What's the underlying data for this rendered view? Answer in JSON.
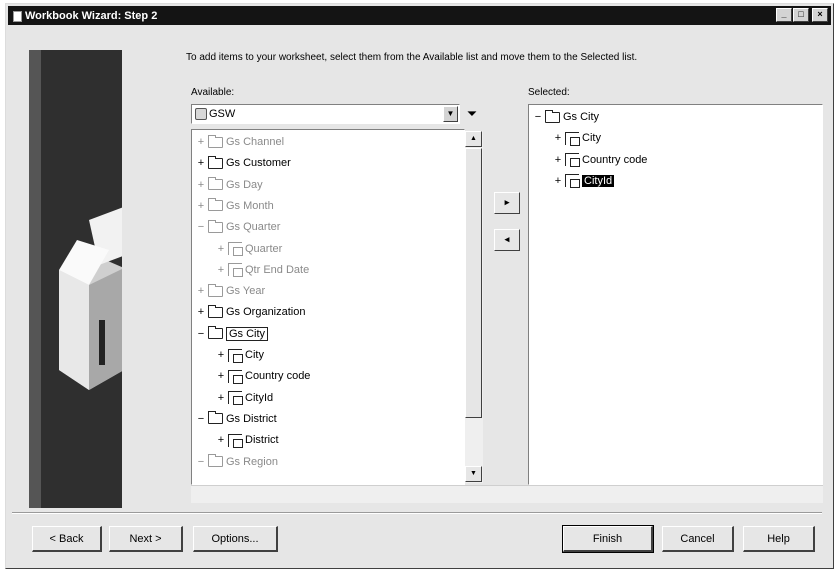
{
  "window": {
    "title": "Workbook Wizard: Step 2",
    "controls": [
      "_",
      "□",
      "×"
    ]
  },
  "instructions": "To add items to your worksheet, select them from the Available list and move them to the Selected list.",
  "available": {
    "label": "Available:",
    "combo_value": "GSW",
    "rows": [
      {
        "exp": "+",
        "icon": "folder",
        "text": "Gs Channel",
        "style": "dim"
      },
      {
        "exp": "+",
        "icon": "folder",
        "text": "Gs Customer",
        "style": ""
      },
      {
        "exp": "+",
        "icon": "folder",
        "text": "Gs Day",
        "style": "dim"
      },
      {
        "exp": "+",
        "icon": "folder",
        "text": "Gs Month",
        "style": "dim"
      },
      {
        "exp": "−",
        "icon": "folder",
        "text": "Gs Quarter",
        "style": "dim"
      },
      {
        "exp": "+",
        "icon": "item",
        "text": "Quarter",
        "style": "dim"
      },
      {
        "exp": "+",
        "icon": "item",
        "text": "Qtr End Date",
        "style": "dim"
      },
      {
        "exp": "+",
        "icon": "folder",
        "text": "Gs Year",
        "style": "dim"
      },
      {
        "exp": "+",
        "icon": "folder",
        "text": "Gs Organization",
        "style": ""
      },
      {
        "exp": "−",
        "icon": "folder",
        "text": "Gs City",
        "style": "boxed"
      },
      {
        "exp": "+",
        "icon": "item",
        "text": "City",
        "style": ""
      },
      {
        "exp": "+",
        "icon": "item",
        "text": "Country code",
        "style": ""
      },
      {
        "exp": "+",
        "icon": "item",
        "text": "CityId",
        "style": ""
      },
      {
        "exp": "−",
        "icon": "folder",
        "text": "Gs District",
        "style": ""
      },
      {
        "exp": "+",
        "icon": "item",
        "text": "District",
        "style": ""
      },
      {
        "exp": "−",
        "icon": "folder",
        "text": "Gs Region",
        "style": "dim"
      }
    ]
  },
  "selected": {
    "label": "Selected:",
    "rows": [
      {
        "exp": "−",
        "icon": "folder",
        "text": "Gs City",
        "style": ""
      },
      {
        "exp": "+",
        "icon": "item",
        "text": "City",
        "style": ""
      },
      {
        "exp": "+",
        "icon": "item",
        "text": "Country code",
        "style": ""
      },
      {
        "exp": "+",
        "icon": "item",
        "text": "CityId",
        "style": "sel"
      }
    ]
  },
  "move_buttons": {
    "add": "▸",
    "remove": "◂"
  },
  "buttons": {
    "back": "< Back",
    "next": "Next >",
    "options": "Options...",
    "finish": "Finish",
    "cancel": "Cancel",
    "help": "Help"
  }
}
